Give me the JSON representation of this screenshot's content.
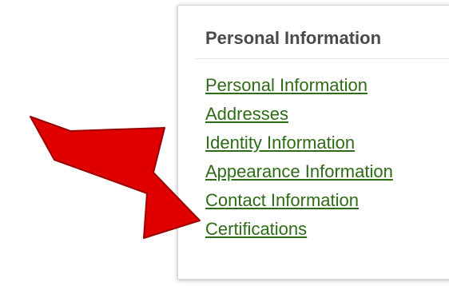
{
  "menu": {
    "heading": "Personal Information",
    "items": [
      {
        "label": "Personal Information"
      },
      {
        "label": "Addresses"
      },
      {
        "label": "Identity Information"
      },
      {
        "label": "Appearance Information"
      },
      {
        "label": "Contact Information"
      },
      {
        "label": "Certifications"
      }
    ],
    "link_color": "#2e6b16",
    "heading_color": "#4a4a4a"
  },
  "annotation": {
    "icon": "red-arrow-icon",
    "color": "#e00000",
    "points_to": "Contact Information"
  }
}
